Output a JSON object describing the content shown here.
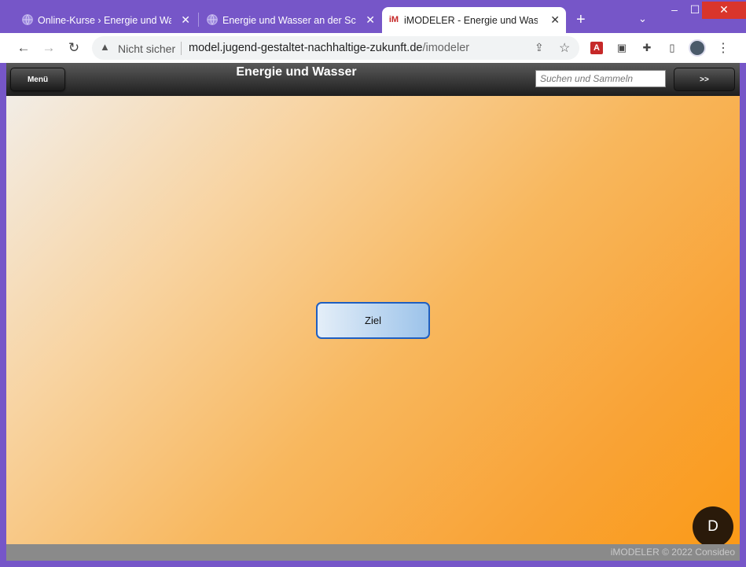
{
  "browser": {
    "tabs": [
      {
        "title": "Online-Kurse › Energie und Wass",
        "active": false
      },
      {
        "title": "Energie und Wasser an der Schu",
        "active": false
      },
      {
        "title": "iMODELER - Energie und Wasse",
        "active": true
      }
    ],
    "new_tab_label": "+",
    "window_controls": {
      "minimize": "–",
      "maximize": "☐",
      "close": "✕"
    },
    "address": {
      "security_label": "Nicht sicher",
      "host": "model.jugend-gestaltet-nachhaltige-zukunft.de",
      "path": "/imodeler"
    },
    "extensions": [
      "pdf-icon",
      "clipboard-icon",
      "puzzle-icon",
      "sidepanel-icon"
    ],
    "active_tab_favicon": "iM",
    "pdf_ext_label": "A"
  },
  "app": {
    "menu_label": "Menü",
    "title": "Energie und Wasser",
    "search_placeholder": "Suchen und Sammeln",
    "expand_label": ">>",
    "node_label": "Ziel",
    "avatar_initial": "D",
    "copyright": "iMODELER © 2022 Consideo",
    "colors": {
      "header": "#2a2a2a",
      "node_border": "#1f5fc1",
      "canvas_start": "#f2ede6",
      "canvas_end": "#fa9a17"
    }
  }
}
